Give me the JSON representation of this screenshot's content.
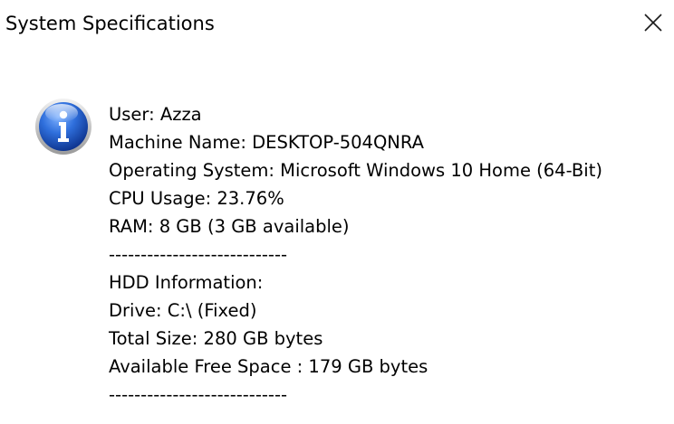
{
  "dialog": {
    "title": "System Specifications",
    "close_icon": "close-icon",
    "info_icon": "information-icon",
    "accent_color": "#1f5fc4"
  },
  "message": {
    "lines": [
      "User: Azza",
      "Machine Name: DESKTOP-504QNRA",
      "Operating System: Microsoft Windows 10 Home (64-Bit)",
      "CPU Usage: 23.76%",
      "RAM: 8 GB (3 GB available)",
      "----------------------------",
      "HDD Information:",
      "Drive: C:\\ (Fixed)",
      "Total Size: 280 GB bytes",
      "Available Free Space : 179 GB bytes",
      "----------------------------"
    ]
  }
}
